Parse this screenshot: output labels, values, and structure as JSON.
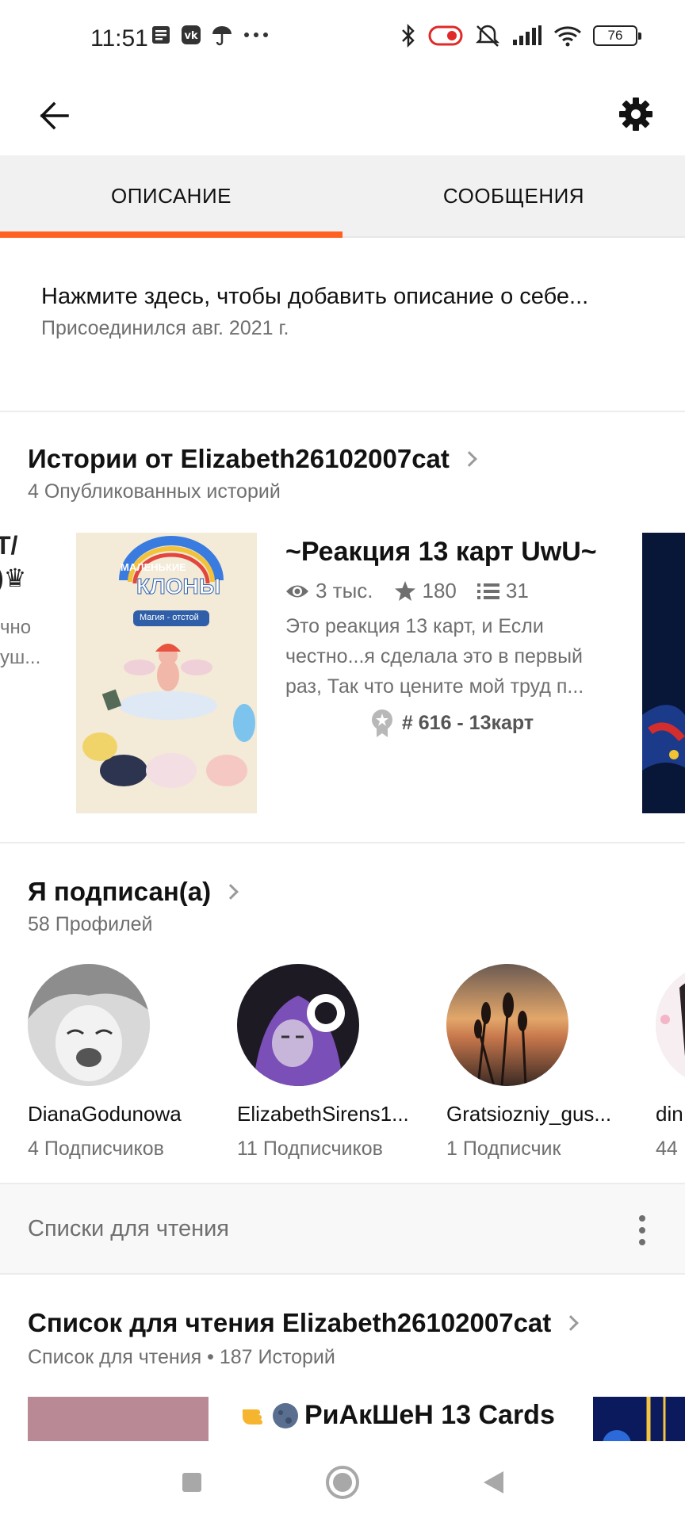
{
  "status_bar": {
    "time": "11:51",
    "battery": "76",
    "left_icons": [
      "notes-icon",
      "vk-icon",
      "umbrella-icon",
      "more-dots-icon"
    ],
    "right_icons": [
      "bluetooth-icon",
      "vpn-icon",
      "mute-icon",
      "signal-icon",
      "wifi-icon"
    ]
  },
  "app_bar": {
    "back_icon": "arrow-left-icon",
    "settings_icon": "gear-icon"
  },
  "tabs": [
    {
      "label": "ОПИСАНИЕ",
      "active": true
    },
    {
      "label": "СООБЩЕНИЯ",
      "active": false
    }
  ],
  "colors": {
    "accent": "#ff6122",
    "text_primary": "#121212",
    "text_secondary": "#6f6f6f"
  },
  "about": {
    "description_prompt": "Нажмите здесь, чтобы добавить описание о себе...",
    "joined": "Присоединился авг. 2021 г."
  },
  "stories": {
    "title": "Истории от Elizabeth26102007cat",
    "count_label": "4 Опубликованных историй",
    "partial_left": {
      "line1": "Т/",
      "line2": ")♛",
      "line3": "чно",
      "line4": "уш..."
    },
    "featured": {
      "title": "~Реакция 13 карт UwU~",
      "reads": "3 тыс.",
      "votes": "180",
      "parts": "31",
      "description": "Это реакция 13 карт, и Если честно...я сделала это в первый раз, Так что цените мой труд п...",
      "rank": "# 616 - 13карт",
      "cover_text": {
        "top": "МАЛЕНЬКИЕ",
        "main": "КЛОНЫ",
        "sub": "Магия - отстой"
      }
    }
  },
  "following": {
    "title": "Я подписан(а)",
    "count_label": "58 Профилей",
    "profiles": [
      {
        "name": "DianaGodunowa",
        "followers": "4 Подписчиков"
      },
      {
        "name": "ElizabethSirens1...",
        "followers": "11 Подписчиков"
      },
      {
        "name": "Gratsiozniy_gus...",
        "followers": "1 Подписчик"
      },
      {
        "name": "din",
        "followers": "44"
      }
    ]
  },
  "reading_lists": {
    "header": "Списки для чтения",
    "list_title": "Список для чтения Elizabeth26102007cat",
    "list_sub": "Список для чтения • 187 Историй",
    "first_story_title": "РиАкШеН 13 Cards"
  },
  "nav_bar": {
    "icons": [
      "recents-square-icon",
      "home-circle-icon",
      "back-triangle-icon"
    ]
  }
}
